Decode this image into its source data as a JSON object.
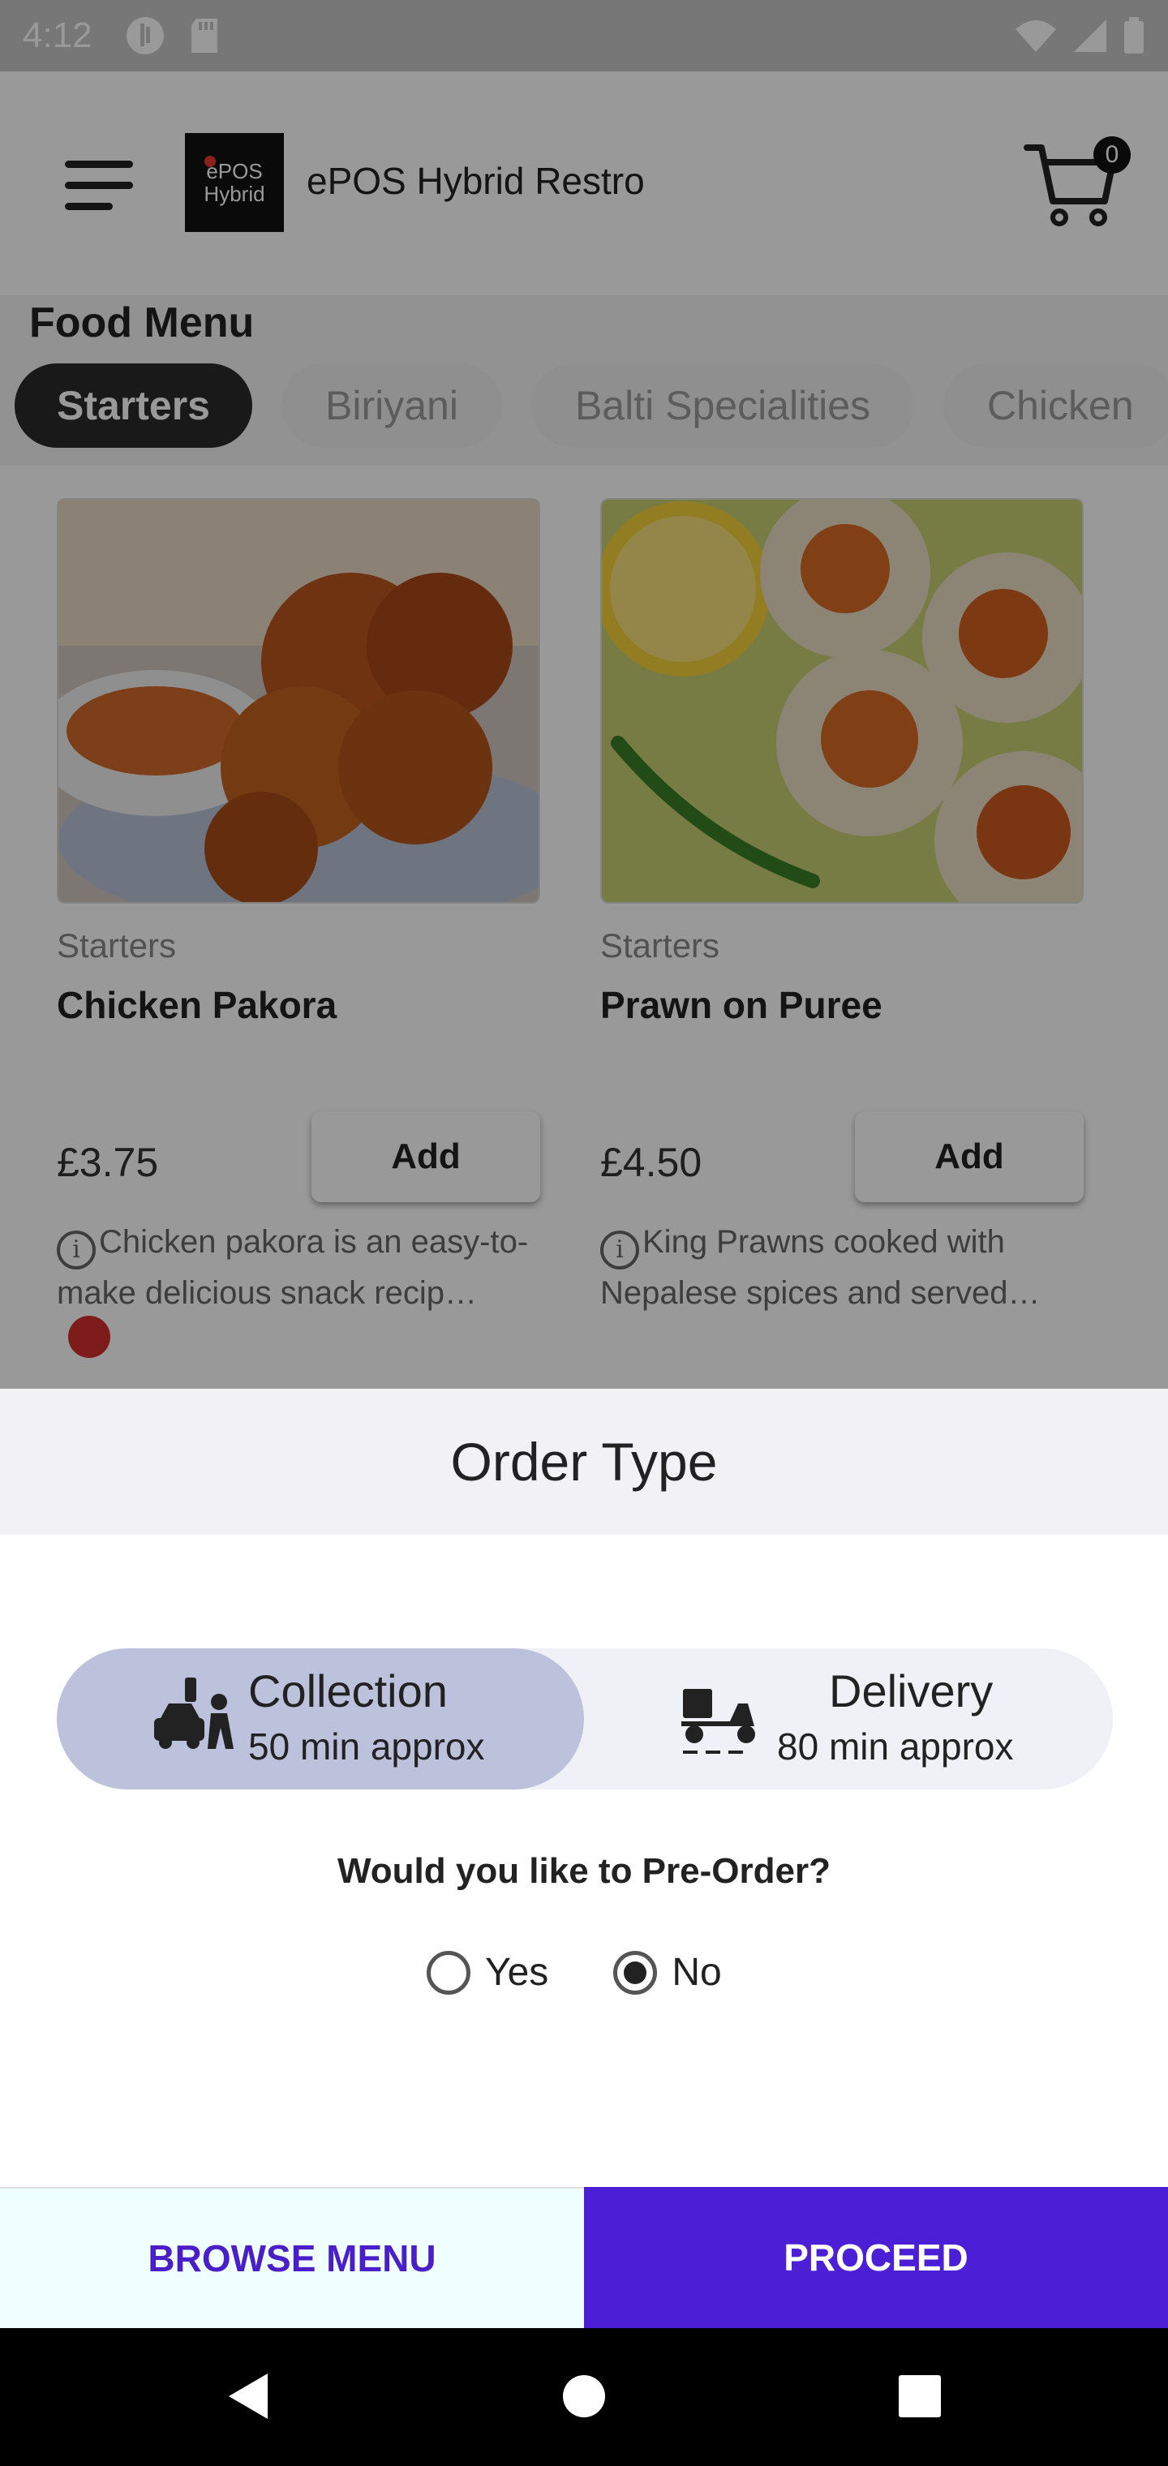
{
  "status_bar": {
    "time": "4:12"
  },
  "app": {
    "brand_name": "ePOS Hybrid Restro",
    "logo_line1": "ePOS",
    "logo_line2": "Hybrid",
    "cart_count": "0"
  },
  "menu": {
    "title": "Food Menu",
    "categories": [
      "Starters",
      "Biriyani",
      "Balti Specialities",
      "Chicken"
    ],
    "items": [
      {
        "category": "Starters",
        "name": "Chicken Pakora",
        "price": "£3.75",
        "add_label": "Add",
        "description": "Chicken pakora is an easy-to-make delicious snack recip…"
      },
      {
        "category": "Starters",
        "name": "Prawn on Puree",
        "price": "£4.50",
        "add_label": "Add",
        "description": "King Prawns cooked with Nepalese spices and served…"
      }
    ]
  },
  "order_type": {
    "title": "Order Type",
    "collection": {
      "label": "Collection",
      "time": "50 min approx",
      "selected": true
    },
    "delivery": {
      "label": "Delivery",
      "time": "80 min approx",
      "selected": false
    },
    "preorder_question": "Would you like to Pre-Order?",
    "yes_label": "Yes",
    "no_label": "No",
    "preorder_selected": "No"
  },
  "actions": {
    "browse_label": "BROWSE MENU",
    "proceed_label": "PROCEED"
  },
  "colors": {
    "accent": "#4b1fd6",
    "selected_option": "#bcc2dc"
  }
}
